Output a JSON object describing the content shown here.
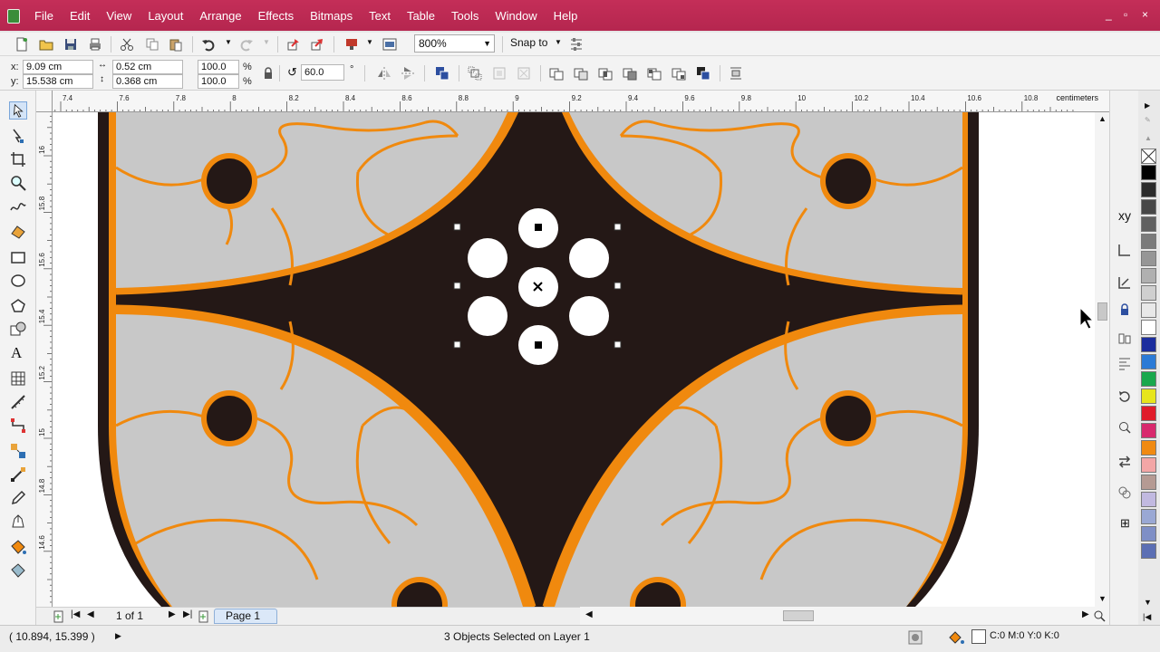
{
  "menubar": {
    "items": [
      "File",
      "Edit",
      "View",
      "Layout",
      "Arrange",
      "Effects",
      "Bitmaps",
      "Text",
      "Table",
      "Tools",
      "Window",
      "Help"
    ],
    "window_controls": [
      "_",
      "▫",
      "×"
    ]
  },
  "toolbar": {
    "zoom_value": "800%",
    "snap_label": "Snap to"
  },
  "property_bar": {
    "x_label": "x:",
    "x_value": "9.09 cm",
    "y_label": "y:",
    "y_value": "15.538 cm",
    "width_value": "0.52 cm",
    "height_value": "0.368 cm",
    "scale_x": "100.0",
    "scale_y": "100.0",
    "percent": "%",
    "rotation_value": "60.0",
    "degree": "°"
  },
  "ruler": {
    "unit": "centimeters",
    "h_ticks": [
      "7.4",
      "7.6",
      "7.8",
      "8",
      "8.2",
      "8.4",
      "8.6",
      "8.8",
      "9",
      "9.2",
      "9.4",
      "9.6",
      "9.8",
      "10",
      "10.2",
      "10.4",
      "10.6",
      "10.8"
    ],
    "v_ticks": [
      "16",
      "15.8",
      "15.6",
      "15.4",
      "15.2",
      "15",
      "14.8",
      "14.6"
    ]
  },
  "pagenav": {
    "page_count": "1 of 1",
    "page_tab": "Page 1"
  },
  "status": {
    "cursor_coords": "( 10.894, 15.399 )",
    "selection": "3 Objects Selected on Layer 1",
    "fill_info": "C:0 M:0 Y:0 K:0"
  },
  "colors": {
    "title_bar": "#c42e58",
    "shape_dark": "#241816",
    "shape_orange": "#f0890e",
    "shape_gray": "#c8c8c8"
  },
  "palette": [
    "#000000",
    "#2b2b2b",
    "#474747",
    "#606060",
    "#7b7b7b",
    "#969696",
    "#b0b0b0",
    "#cfcfcf",
    "#e8e8e8",
    "#ffffff",
    "#1b2d9e",
    "#2b7ad6",
    "#1aa84d",
    "#e7e51c",
    "#e01b2a",
    "#d8296d",
    "#f08a12",
    "#f3a6a6",
    "#b59a93",
    "#c1b9e0",
    "#9aa8d4",
    "#7f8fc6",
    "#5c6fb4"
  ]
}
